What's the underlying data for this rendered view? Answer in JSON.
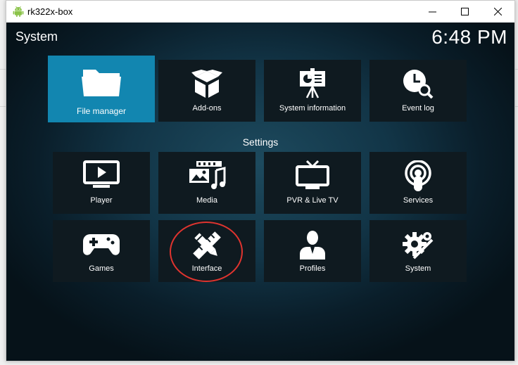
{
  "window": {
    "title": "rk322x-box",
    "app_icon": "android-icon",
    "controls": [
      "minimize-icon",
      "maximize-icon",
      "close-icon"
    ]
  },
  "kodi": {
    "screen_title": "System",
    "clock": "6:48 PM",
    "section_label": "Settings"
  },
  "top_row": [
    {
      "label": "File manager",
      "icon": "folder-icon",
      "focused": true
    },
    {
      "label": "Add-ons",
      "icon": "addon-box-icon"
    },
    {
      "label": "System information",
      "icon": "presentation-icon"
    },
    {
      "label": "Event log",
      "icon": "clock-search-icon"
    }
  ],
  "settings_row1": [
    {
      "label": "Player",
      "icon": "player-icon"
    },
    {
      "label": "Media",
      "icon": "media-icon"
    },
    {
      "label": "PVR & Live TV",
      "icon": "tv-icon"
    },
    {
      "label": "Services",
      "icon": "podcast-icon"
    }
  ],
  "settings_row2": [
    {
      "label": "Games",
      "icon": "gamepad-icon"
    },
    {
      "label": "Interface",
      "icon": "pencil-ruler-icon",
      "annotated": true
    },
    {
      "label": "Profiles",
      "icon": "profile-icon"
    },
    {
      "label": "System",
      "icon": "gear-icon"
    }
  ],
  "colors": {
    "focus": "#1286b0",
    "tile": "#0f1a20",
    "annotation": "#e0342f"
  }
}
